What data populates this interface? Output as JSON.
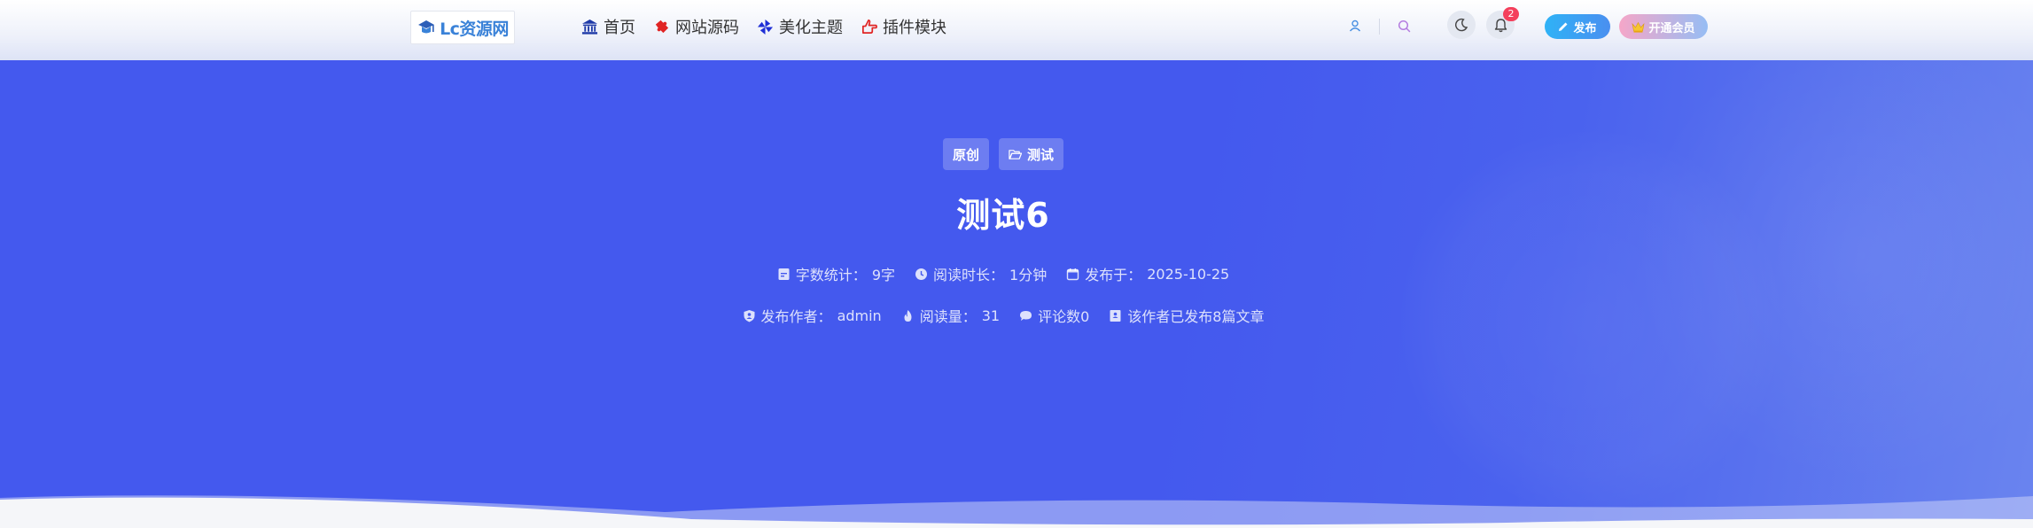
{
  "header": {
    "logo_text": "Lc资源网",
    "nav": [
      {
        "label": "首页",
        "icon": "bank-icon"
      },
      {
        "label": "网站源码",
        "icon": "puzzle-icon"
      },
      {
        "label": "美化主题",
        "icon": "pinwheel-icon"
      },
      {
        "label": "插件模块",
        "icon": "hand-point-icon"
      }
    ],
    "notification_count": "2",
    "publish_label": "发布",
    "vip_label": "开通会员"
  },
  "post": {
    "tags": [
      "原创",
      "测试"
    ],
    "title": "测试6",
    "meta_row1": [
      {
        "label": "字数统计：",
        "value": "9字"
      },
      {
        "label": "阅读时长：",
        "value": "1分钟"
      },
      {
        "label": "发布于：",
        "value": "2025-10-25"
      }
    ],
    "meta_row2": [
      {
        "label": "发布作者：",
        "value": "admin"
      },
      {
        "label": "阅读量：",
        "value": "31"
      },
      {
        "label": "评论数0",
        "value": ""
      },
      {
        "label": "该作者已发布8篇文章",
        "value": ""
      }
    ]
  },
  "colors": {
    "hero_blue": "#4459ee",
    "badge_red": "#f4405c",
    "publish_blue": "#2fb2f6",
    "vip_pink": "#f5a6c8"
  }
}
